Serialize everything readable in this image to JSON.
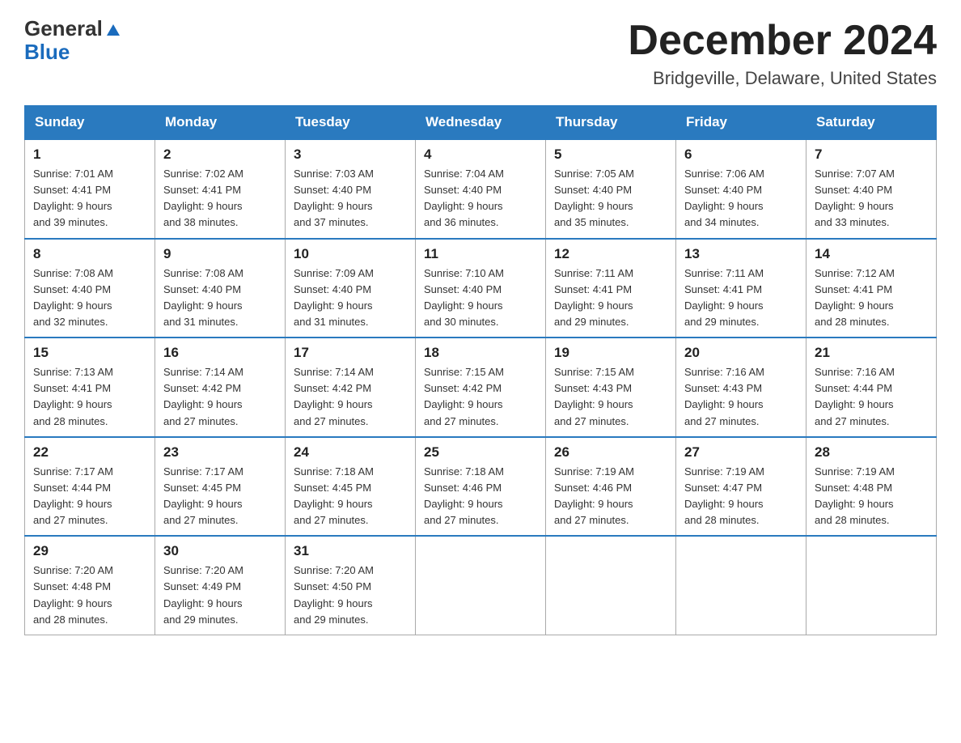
{
  "logo": {
    "general": "General",
    "blue": "Blue"
  },
  "header": {
    "month": "December 2024",
    "location": "Bridgeville, Delaware, United States"
  },
  "days_of_week": [
    "Sunday",
    "Monday",
    "Tuesday",
    "Wednesday",
    "Thursday",
    "Friday",
    "Saturday"
  ],
  "weeks": [
    [
      {
        "day": "1",
        "sunrise": "7:01 AM",
        "sunset": "4:41 PM",
        "daylight": "9 hours and 39 minutes."
      },
      {
        "day": "2",
        "sunrise": "7:02 AM",
        "sunset": "4:41 PM",
        "daylight": "9 hours and 38 minutes."
      },
      {
        "day": "3",
        "sunrise": "7:03 AM",
        "sunset": "4:40 PM",
        "daylight": "9 hours and 37 minutes."
      },
      {
        "day": "4",
        "sunrise": "7:04 AM",
        "sunset": "4:40 PM",
        "daylight": "9 hours and 36 minutes."
      },
      {
        "day": "5",
        "sunrise": "7:05 AM",
        "sunset": "4:40 PM",
        "daylight": "9 hours and 35 minutes."
      },
      {
        "day": "6",
        "sunrise": "7:06 AM",
        "sunset": "4:40 PM",
        "daylight": "9 hours and 34 minutes."
      },
      {
        "day": "7",
        "sunrise": "7:07 AM",
        "sunset": "4:40 PM",
        "daylight": "9 hours and 33 minutes."
      }
    ],
    [
      {
        "day": "8",
        "sunrise": "7:08 AM",
        "sunset": "4:40 PM",
        "daylight": "9 hours and 32 minutes."
      },
      {
        "day": "9",
        "sunrise": "7:08 AM",
        "sunset": "4:40 PM",
        "daylight": "9 hours and 31 minutes."
      },
      {
        "day": "10",
        "sunrise": "7:09 AM",
        "sunset": "4:40 PM",
        "daylight": "9 hours and 31 minutes."
      },
      {
        "day": "11",
        "sunrise": "7:10 AM",
        "sunset": "4:40 PM",
        "daylight": "9 hours and 30 minutes."
      },
      {
        "day": "12",
        "sunrise": "7:11 AM",
        "sunset": "4:41 PM",
        "daylight": "9 hours and 29 minutes."
      },
      {
        "day": "13",
        "sunrise": "7:11 AM",
        "sunset": "4:41 PM",
        "daylight": "9 hours and 29 minutes."
      },
      {
        "day": "14",
        "sunrise": "7:12 AM",
        "sunset": "4:41 PM",
        "daylight": "9 hours and 28 minutes."
      }
    ],
    [
      {
        "day": "15",
        "sunrise": "7:13 AM",
        "sunset": "4:41 PM",
        "daylight": "9 hours and 28 minutes."
      },
      {
        "day": "16",
        "sunrise": "7:14 AM",
        "sunset": "4:42 PM",
        "daylight": "9 hours and 27 minutes."
      },
      {
        "day": "17",
        "sunrise": "7:14 AM",
        "sunset": "4:42 PM",
        "daylight": "9 hours and 27 minutes."
      },
      {
        "day": "18",
        "sunrise": "7:15 AM",
        "sunset": "4:42 PM",
        "daylight": "9 hours and 27 minutes."
      },
      {
        "day": "19",
        "sunrise": "7:15 AM",
        "sunset": "4:43 PM",
        "daylight": "9 hours and 27 minutes."
      },
      {
        "day": "20",
        "sunrise": "7:16 AM",
        "sunset": "4:43 PM",
        "daylight": "9 hours and 27 minutes."
      },
      {
        "day": "21",
        "sunrise": "7:16 AM",
        "sunset": "4:44 PM",
        "daylight": "9 hours and 27 minutes."
      }
    ],
    [
      {
        "day": "22",
        "sunrise": "7:17 AM",
        "sunset": "4:44 PM",
        "daylight": "9 hours and 27 minutes."
      },
      {
        "day": "23",
        "sunrise": "7:17 AM",
        "sunset": "4:45 PM",
        "daylight": "9 hours and 27 minutes."
      },
      {
        "day": "24",
        "sunrise": "7:18 AM",
        "sunset": "4:45 PM",
        "daylight": "9 hours and 27 minutes."
      },
      {
        "day": "25",
        "sunrise": "7:18 AM",
        "sunset": "4:46 PM",
        "daylight": "9 hours and 27 minutes."
      },
      {
        "day": "26",
        "sunrise": "7:19 AM",
        "sunset": "4:46 PM",
        "daylight": "9 hours and 27 minutes."
      },
      {
        "day": "27",
        "sunrise": "7:19 AM",
        "sunset": "4:47 PM",
        "daylight": "9 hours and 28 minutes."
      },
      {
        "day": "28",
        "sunrise": "7:19 AM",
        "sunset": "4:48 PM",
        "daylight": "9 hours and 28 minutes."
      }
    ],
    [
      {
        "day": "29",
        "sunrise": "7:20 AM",
        "sunset": "4:48 PM",
        "daylight": "9 hours and 28 minutes."
      },
      {
        "day": "30",
        "sunrise": "7:20 AM",
        "sunset": "4:49 PM",
        "daylight": "9 hours and 29 minutes."
      },
      {
        "day": "31",
        "sunrise": "7:20 AM",
        "sunset": "4:50 PM",
        "daylight": "9 hours and 29 minutes."
      },
      null,
      null,
      null,
      null
    ]
  ],
  "labels": {
    "sunrise_prefix": "Sunrise: ",
    "sunset_prefix": "Sunset: ",
    "daylight_prefix": "Daylight: "
  }
}
